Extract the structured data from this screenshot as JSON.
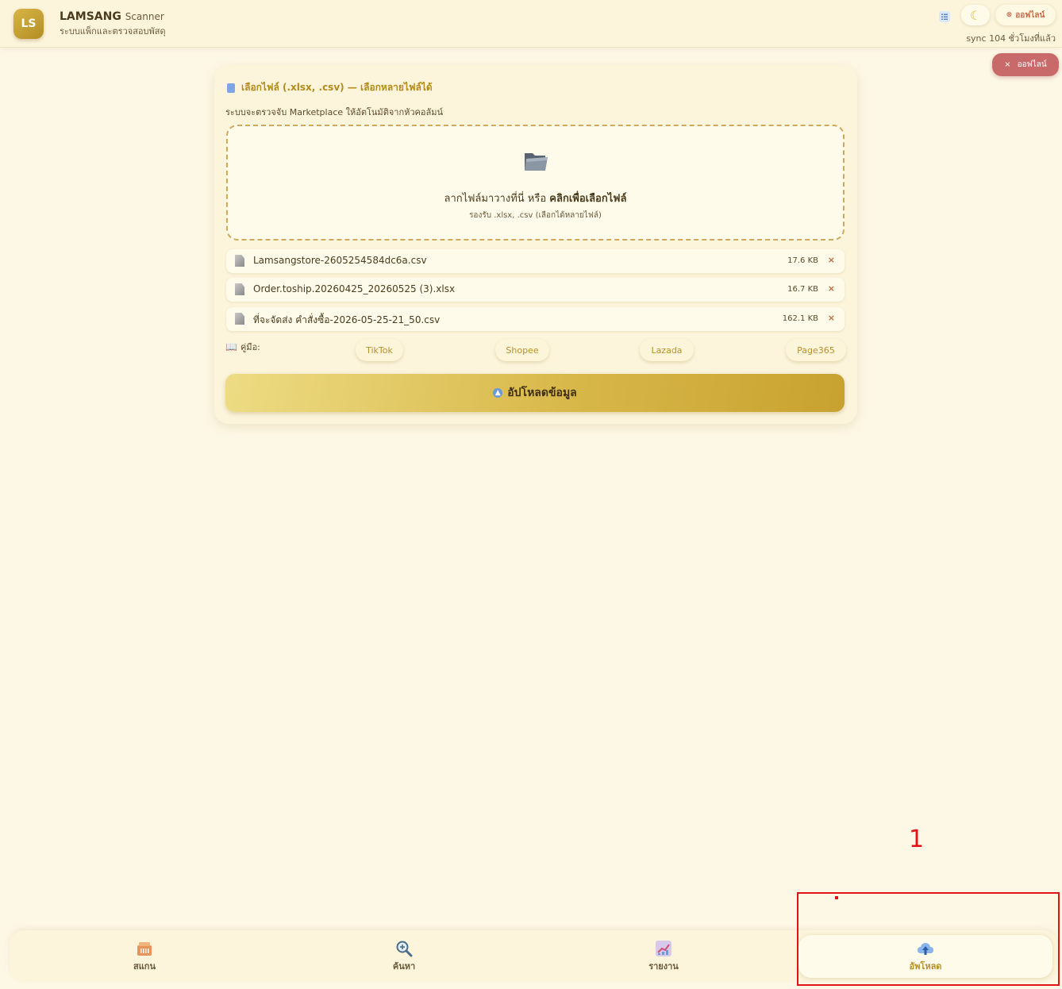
{
  "header": {
    "logo": "LS",
    "brand_name": "LAMSANG",
    "brand_word": "Scanner",
    "tagline": "ระบบแพ็กและตรวจสอบพัสดุ",
    "status": "ออฟไลน์",
    "sync": "sync 104 ชั่วโมงที่แล้ว"
  },
  "toast": {
    "close": "×",
    "text": "ออฟไลน์"
  },
  "upload_card": {
    "title": "เลือกไฟล์ (.xlsx, .csv) — เลือกหลายไฟล์ได้",
    "description": "ระบบจะตรวจจับ Marketplace ให้อัตโนมัติจากหัวคอลัมน์",
    "dropzone": {
      "text": "ลากไฟล์มาวางที่นี่ หรือ",
      "link": "คลิกเพื่อเลือกไฟล์",
      "hint": "รองรับ .xlsx, .csv (เลือกได้หลายไฟล์)"
    },
    "files": [
      {
        "name": "Lamsangstore-2605254584dc6a.csv",
        "size": "17.6 KB",
        "remove": "×"
      },
      {
        "name": "Order.toship.20260425_20260525 (3).xlsx",
        "size": "16.7 KB",
        "remove": "×"
      },
      {
        "name": "ที่จะจัดส่ง คำสั่งซื้อ-2026-05-25-21_50.csv",
        "size": "162.1 KB",
        "remove": "×"
      }
    ],
    "guide_label": "คู่มือ:",
    "guides": [
      "TikTok",
      "Shopee",
      "Lazada",
      "Page365"
    ],
    "upload_button": "อัปโหลดข้อมูล"
  },
  "bottom_nav": {
    "items": [
      {
        "label": "สแกน",
        "icon": "box-icon"
      },
      {
        "label": "ค้นหา",
        "icon": "magnifier-icon"
      },
      {
        "label": "รายงาน",
        "icon": "chart-icon"
      },
      {
        "label": "อัพโหลด",
        "icon": "cloud-upload-icon",
        "active": true
      }
    ]
  },
  "annotation": {
    "number": "1"
  },
  "colors": {
    "background": "#fdf8e6",
    "accent": "#b8902a",
    "button_gradient_start": "#eddc84",
    "button_gradient_end": "#c8a230",
    "toast": "#c96a6a",
    "annotation": "#e01414"
  }
}
